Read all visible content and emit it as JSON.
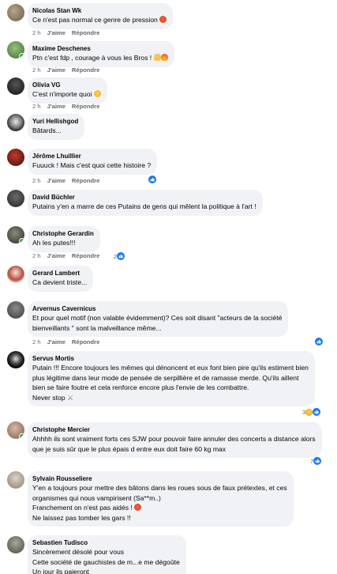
{
  "colors": {
    "like_blue": "#1877f2",
    "bubble": "#f0f2f5",
    "meta_gray": "#65676b",
    "online_green": "#31a24c"
  },
  "actions": {
    "time": "2 h",
    "like": "J'aime",
    "reply": "Répondre"
  },
  "comments": [
    {
      "author": "Nicolas Stan Wk",
      "lines": [
        "Ce n'est pas normal ce genre de pression"
      ],
      "emoji": "angry-face-emoji"
    },
    {
      "author": "Maxime Deschenes",
      "lines": [
        "Ptn c'est fdp , courage à vous les Bros !"
      ],
      "emoji": "folded-hands-fire-emoji"
    },
    {
      "author": "Olivia VG",
      "lines": [
        "C'est n'importe quoi"
      ],
      "emoji": "smirk-face-emoji"
    },
    {
      "author": "Yuri Hellishgod",
      "lines": [
        "Bâtards..."
      ]
    },
    {
      "author": "Jérôme Lhuillier",
      "lines": [
        "Fuuuck ! Mais c'est quoi cette histoire ?"
      ],
      "reactions": "like"
    },
    {
      "author": "David Büchler",
      "lines": [
        "Putains y'en a marre de ces Putains de gens qui mêlent la politique à l'art !"
      ]
    },
    {
      "author": "Christophe Gerardin",
      "lines": [
        "Ah les putes!!!"
      ],
      "reactions": "like",
      "reaction_count": "2"
    },
    {
      "author": "Gerard Lambert",
      "lines": [
        "Ca devient triste..."
      ]
    },
    {
      "author": "Arvernus Cavernicus",
      "lines": [
        "Et pour quel motif (non valable évidemment)? Ces soit disant \"acteurs de la société",
        "bienveillants \" sont la malveillance même..."
      ],
      "reactions": "like"
    },
    {
      "author": "Servus Mortis",
      "lines": [
        "Putain !!! Encore toujours les mêmes qui dénoncent et eux font bien pire qu'ils estiment bien",
        "plus légitime dans leur mode de pensée de serpillière et de ramasse merde. Qu'ils aillent",
        "bien se faire foutre et cela renforce encore plus l'envie de les combattre.",
        "Never stop"
      ],
      "reactions": "laugh-like",
      "reaction_count": "3"
    },
    {
      "author": "Christophe Mercier",
      "lines": [
        "Ahhhh ils sont vraiment forts ces SJW pour pouvoir faire annuler des concerts a distance alors",
        "que je suis sûr que le plus épais d entre eux doit faire 60 kg max"
      ],
      "reactions": "like",
      "reaction_count": "7"
    },
    {
      "author": "Sylvain Rousseliere",
      "lines": [
        "Y'en a toujours pour mettre des bâtons dans les roues sous de faux prétextes, et ces",
        "organismes qui nous vampirisent (Sa**m..)",
        "Franchement on n'est pas aidés !",
        "Ne laissez pas tomber les gars !!"
      ]
    },
    {
      "author": "Sebastien Tudisco",
      "lines": [
        "Sincèrement désolé pour vous",
        "Cette société de gauchistes de m...e me dégoûte",
        "Un jour ils paieront"
      ]
    }
  ]
}
